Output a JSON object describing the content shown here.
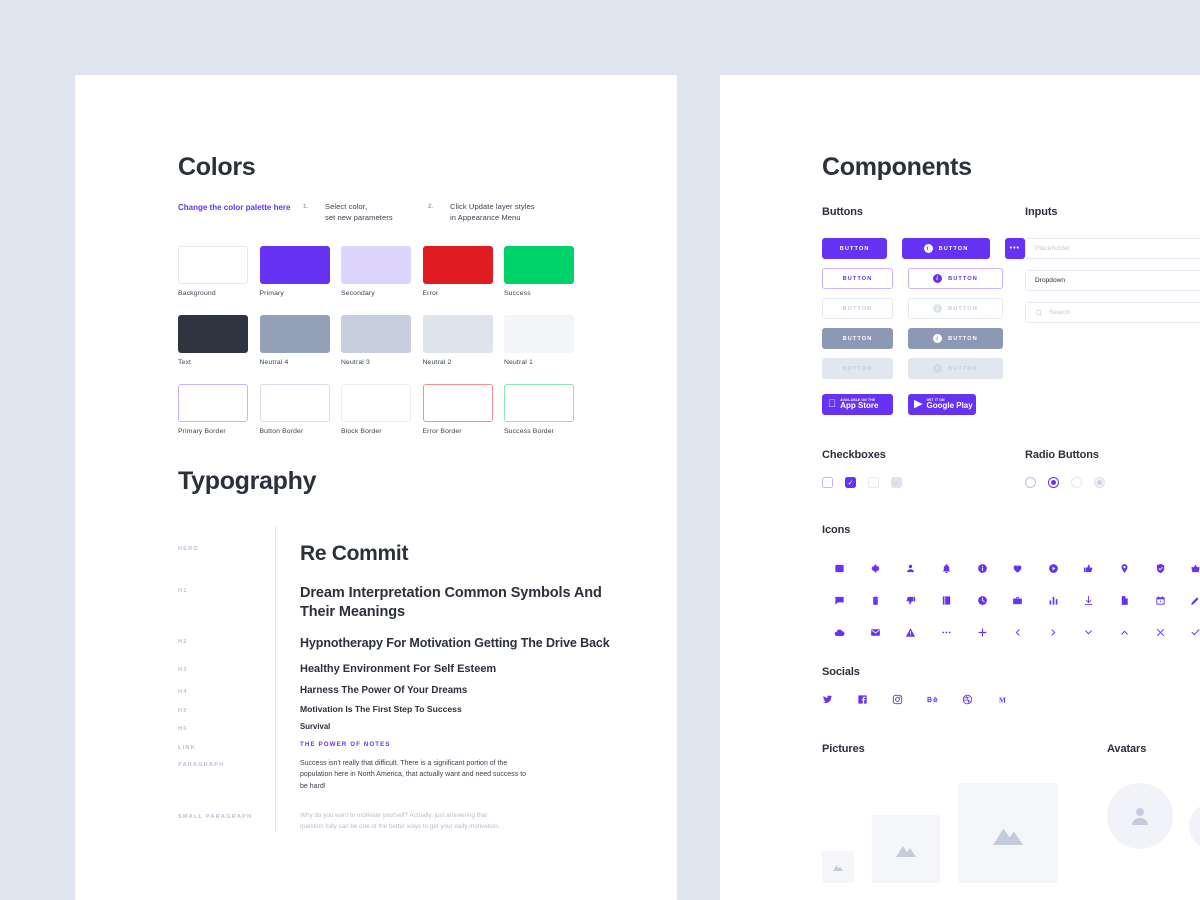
{
  "colors_section": {
    "title": "Colors",
    "notes": {
      "link": "Change the color palette here",
      "steps": [
        {
          "num": "1.",
          "text": "Select color,\nset new parameters"
        },
        {
          "num": "2.",
          "text": "Click Update layer styles\nin Appearance Menu"
        }
      ]
    },
    "swatches": [
      {
        "label": "Background",
        "fill": "#ffffff",
        "border": "#e6e9f1"
      },
      {
        "label": "Primary",
        "fill": "#6633f4",
        "border": "#6633f4"
      },
      {
        "label": "Secondary",
        "fill": "#ddd4fb",
        "border": "#ddd4fb"
      },
      {
        "label": "Error",
        "fill": "#e01b22",
        "border": "#e01b22"
      },
      {
        "label": "Success",
        "fill": "#00d26a",
        "border": "#00d26a"
      },
      {
        "label": "Text",
        "fill": "#2e3440",
        "border": "#2e3440"
      },
      {
        "label": "Neutral 4",
        "fill": "#93a0b8",
        "border": "#93a0b8"
      },
      {
        "label": "Neutral 3",
        "fill": "#c7cedd",
        "border": "#c7cedd"
      },
      {
        "label": "Neutral 2",
        "fill": "#dfe3ec",
        "border": "#dfe3ec"
      },
      {
        "label": "Neutral 1",
        "fill": "#f4f5f9",
        "border": "#f4f5f9"
      },
      {
        "label": "Primary Border",
        "fill": "#ffffff",
        "border": "#c9b4fb"
      },
      {
        "label": "Button Border",
        "fill": "#ffffff",
        "border": "#d9dde8"
      },
      {
        "label": "Block Border",
        "fill": "#ffffff",
        "border": "#e9ecf3"
      },
      {
        "label": "Error Border",
        "fill": "#ffffff",
        "border": "#f58e91"
      },
      {
        "label": "Success Border",
        "fill": "#ffffff",
        "border": "#8ae6b8"
      }
    ]
  },
  "typography_section": {
    "title": "Typography",
    "rows": [
      {
        "key": "Hero",
        "value": "Re Commit"
      },
      {
        "key": "H1",
        "value": "Dream Interpretation Common Symbols And Their Meanings"
      },
      {
        "key": "H2",
        "value": "Hypnotherapy For Motivation Getting The Drive Back"
      },
      {
        "key": "H3",
        "value": "Healthy Environment For Self Esteem"
      },
      {
        "key": "H4",
        "value": "Harness The Power Of Your Dreams"
      },
      {
        "key": "H5",
        "value": "Motivation Is The First Step To Success"
      },
      {
        "key": "H6",
        "value": "Survival"
      },
      {
        "key": "Link",
        "value": "THE POWER OF NOTES"
      },
      {
        "key": "Paragraph",
        "value": "Success isn't really that difficult. There is a significant portion of the population here in North America, that actually want and need success to be hard!"
      },
      {
        "key": "Small Paragraph",
        "value": "Why do you want to motivate yourself? Actually, just answering that question fully can be one of the better ways to get your daily motivation."
      }
    ]
  },
  "components_section": {
    "title": "Components",
    "buttons": {
      "heading": "Buttons",
      "label": "BUTTON",
      "more_label": "•••",
      "rows": [
        {
          "style": "solid",
          "icon": "i"
        },
        {
          "style": "outline",
          "icon": "i"
        },
        {
          "style": "ghost",
          "icon": "i"
        },
        {
          "style": "neutral",
          "icon": "i"
        },
        {
          "style": "disabled",
          "icon": "i"
        }
      ],
      "stores": [
        {
          "small": "AVAILABLE ON THE",
          "big": "App Store",
          "glyph": "apple-icon"
        },
        {
          "small": "GET IT ON",
          "big": "Google Play",
          "glyph": "play-icon"
        }
      ]
    },
    "inputs": {
      "heading": "Inputs",
      "placeholder": "Placeholder",
      "dropdown_value": "Dropdown",
      "search_placeholder": "Search"
    },
    "checkboxes": {
      "heading": "Checkboxes",
      "states": [
        "empty",
        "checked",
        "empty-disabled",
        "checked-disabled"
      ]
    },
    "radios": {
      "heading": "Radio Buttons",
      "states": [
        "empty",
        "selected",
        "empty-disabled",
        "selected-disabled"
      ]
    },
    "icons": {
      "heading": "Icons",
      "names": [
        "image-icon",
        "gear-icon",
        "user-icon",
        "bell-icon",
        "info-icon",
        "heart-icon",
        "play-circle-icon",
        "thumbs-up-icon",
        "location-pin-icon",
        "shield-check-icon",
        "basket-icon",
        "chat-icon",
        "trash-icon",
        "thumbs-down-icon",
        "book-icon",
        "clock-icon",
        "briefcase-icon",
        "bar-chart-icon",
        "download-icon",
        "file-icon",
        "calendar-icon",
        "pencil-icon",
        "cloud-icon",
        "mail-icon",
        "warning-icon",
        "ellipsis-icon",
        "plus-icon",
        "chevron-left-icon",
        "chevron-right-icon",
        "chevron-down-icon",
        "chevron-up-icon",
        "close-icon",
        "check-icon"
      ]
    },
    "socials": {
      "heading": "Socials",
      "names": [
        "twitter-icon",
        "facebook-icon",
        "instagram-icon",
        "behance-icon",
        "dribbble-icon",
        "medium-icon"
      ]
    },
    "pictures": {
      "heading": "Pictures"
    },
    "avatars": {
      "heading": "Avatars"
    }
  },
  "theme": {
    "page_background": "#e0e4ee",
    "card_background": "#ffffff",
    "primary": "#6633f4",
    "text": "#2e3440"
  }
}
